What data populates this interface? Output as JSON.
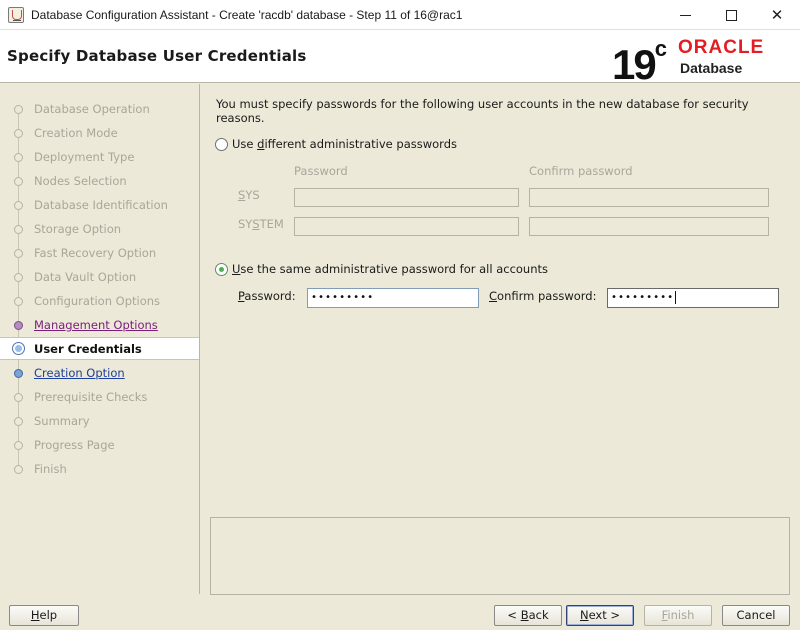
{
  "window": {
    "title": "Database Configuration Assistant - Create 'racdb' database - Step 11 of 16@rac1"
  },
  "header": {
    "title": "Specify Database User Credentials",
    "logo_version": "19",
    "logo_sup": "c",
    "logo_brand": "ORACLE",
    "logo_product": "Database"
  },
  "sidebar": {
    "steps": [
      {
        "label": "Database Operation",
        "state": "done"
      },
      {
        "label": "Creation Mode",
        "state": "done"
      },
      {
        "label": "Deployment Type",
        "state": "done"
      },
      {
        "label": "Nodes Selection",
        "state": "done"
      },
      {
        "label": "Database Identification",
        "state": "done"
      },
      {
        "label": "Storage Option",
        "state": "done"
      },
      {
        "label": "Fast Recovery Option",
        "state": "done"
      },
      {
        "label": "Data Vault Option",
        "state": "done"
      },
      {
        "label": "Configuration Options",
        "state": "done"
      },
      {
        "label": "Management Options",
        "state": "visited"
      },
      {
        "label": "User Credentials",
        "state": "current"
      },
      {
        "label": "Creation Option",
        "state": "next"
      },
      {
        "label": "Prerequisite Checks",
        "state": "todo"
      },
      {
        "label": "Summary",
        "state": "todo"
      },
      {
        "label": "Progress Page",
        "state": "todo"
      },
      {
        "label": "Finish",
        "state": "todo"
      }
    ]
  },
  "main": {
    "intro": "You must specify passwords for the following user accounts in the new database for security reasons.",
    "option_different": {
      "pre": "Use ",
      "mnemonic": "d",
      "post": "ifferent administrative passwords",
      "selected": false
    },
    "columns": {
      "password": "Password",
      "confirm": "Confirm password"
    },
    "rows": [
      {
        "label_pre": "",
        "mnemonic": "S",
        "label_post": "YS"
      },
      {
        "label_pre": "SY",
        "mnemonic": "S",
        "label_post": "TEM"
      }
    ],
    "option_same": {
      "pre": "",
      "mnemonic": "U",
      "post": "se the same administrative password for all accounts",
      "selected": true
    },
    "password_label": {
      "pre": "",
      "mnemonic": "P",
      "post": "assword:"
    },
    "password_value": "•••••••••",
    "confirm_label": {
      "pre": "",
      "mnemonic": "C",
      "post": "onfirm password:"
    },
    "confirm_value": "•••••••••"
  },
  "buttons": {
    "help": {
      "pre": "",
      "mnemonic": "H",
      "post": "elp"
    },
    "back": {
      "pre": "< ",
      "mnemonic": "B",
      "post": "ack"
    },
    "next": {
      "pre": "",
      "mnemonic": "N",
      "post": "ext >"
    },
    "finish": {
      "pre": "",
      "mnemonic": "F",
      "post": "inish"
    },
    "cancel": {
      "label": "Cancel"
    }
  },
  "colors": {
    "oracle_red": "#e21d24",
    "visited_link": "#7a1d7a",
    "next_link": "#1e3f9a",
    "radio_selected": "#4caf50"
  }
}
